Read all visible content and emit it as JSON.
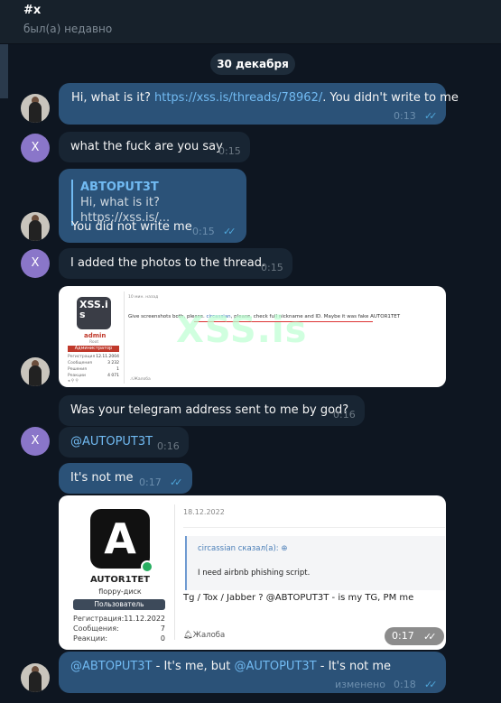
{
  "header": {
    "title": "#x",
    "status": "был(а) недавно"
  },
  "date_pill": "30 декабря",
  "avatars": {
    "self_letter": "X"
  },
  "messages": {
    "m1": {
      "text_before": "Hi, what is it? ",
      "link": "https://xss.is/threads/78962/",
      "text_after": ". You didn't write to me",
      "time": "0:13",
      "ticks": "✓✓"
    },
    "m2": {
      "text": "what the fuck are you say",
      "time": "0:15"
    },
    "m3": {
      "reply_name": "ABTOPUT3T",
      "reply_text": "Hi, what is it? https://xss.is/...",
      "text": "You did not write me",
      "time": "0:15",
      "ticks": "✓✓"
    },
    "m4": {
      "text": "I added the photos to the thread.",
      "time": "0:15"
    },
    "m5": {
      "text": "Was your telegram address sent to me by god?",
      "time": "0:16"
    },
    "m6": {
      "text": "@AUTOPUT3T",
      "time": "0:16"
    },
    "m7": {
      "text": "It's not me",
      "time": "0:17",
      "ticks": "✓✓"
    },
    "m9": {
      "mention1": "@ABTOPUT3T",
      "text_mid": " - It's me, but ",
      "mention2": "@AUTOPUT3T",
      "text_end": " - It's not me",
      "edited": "изменено",
      "time": "0:18",
      "ticks": "✓✓"
    }
  },
  "watermark": "XSS.is",
  "admin_card": {
    "logo_text": "XSS.is",
    "username": "admin",
    "user_title": "Root",
    "role": "Администратор",
    "stats": [
      {
        "label": "Регистрация",
        "value": "12.11.2004"
      },
      {
        "label": "Сообщения",
        "value": "3 232"
      },
      {
        "label": "Решения",
        "value": "1"
      },
      {
        "label": "Реакции",
        "value": "4 071"
      }
    ],
    "time_ago": "10 мин. назад",
    "post_start": "Give screenshots both, please. ",
    "post_mention": "circassian",
    "post_rest": ", please, check full nickname and ID. Maybe it was fake AUTOR1TET",
    "report": "Жалоба"
  },
  "autor_card": {
    "logo_letter": "A",
    "username": "AUTOR1TET",
    "user_title": "floppy-диск",
    "role": "Пользователь",
    "stats": [
      {
        "label": "Регистрация:",
        "value": "11.12.2022"
      },
      {
        "label": "Сообщения:",
        "value": "7"
      },
      {
        "label": "Реакции:",
        "value": "0"
      }
    ],
    "date": "18.12.2022",
    "quote_head": "circassian сказал(а):",
    "quote_text": "I need airbnb phishing script.",
    "post": "Tg / Tox / Jabber ? @ABTOPUT3T - is my TG, PM me",
    "report": "Жалоба",
    "overlay_time": "0:17",
    "overlay_ticks": "✓✓"
  }
}
